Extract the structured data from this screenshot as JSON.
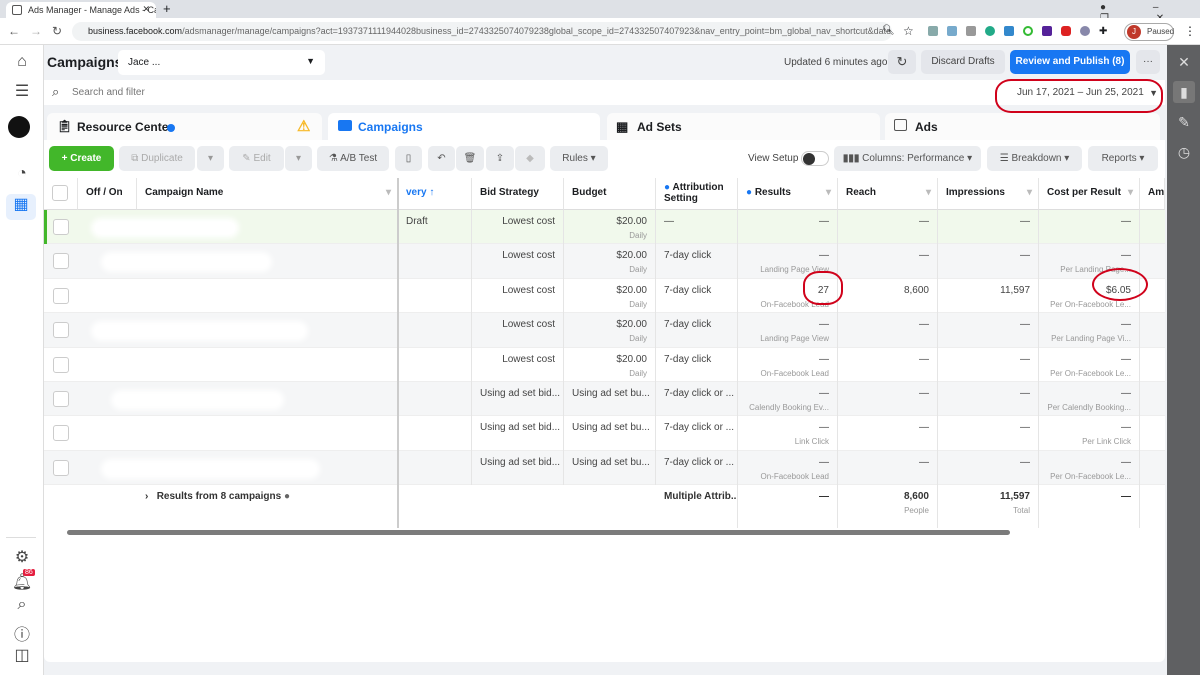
{
  "browser": {
    "tab_title": "Ads Manager - Manage Ads - Ca",
    "url_host": "business.facebook.com",
    "url_path": "/adsmanager/manage/campaigns?act=1937371111944028business_id=2743325074079238global_scope_id=274332507407923&nav_entry_point=bm_global_nav_shortcut&date...",
    "profile_status": "Paused",
    "profile_initial": "J"
  },
  "header": {
    "title": "Campaigns",
    "account": "Jace ...",
    "updated": "Updated 6 minutes ago",
    "discard": "Discard Drafts",
    "publish": "Review and Publish (8)",
    "more": "···"
  },
  "search": {
    "placeholder": "Search and filter",
    "date_range": "Jun 17, 2021 – Jun 25, 2021"
  },
  "tabs": [
    {
      "label": "Resource Center"
    },
    {
      "label": "Campaigns",
      "active": true
    },
    {
      "label": "Ad Sets"
    },
    {
      "label": "Ads"
    }
  ],
  "toolbar": {
    "create": "+ Create",
    "duplicate": "Duplicate",
    "edit": "Edit",
    "ab_test": "A/B Test",
    "rules": "Rules",
    "view_setup": "View Setup",
    "columns": "Columns: Performance",
    "breakdown": "Breakdown",
    "reports": "Reports"
  },
  "sidebar": {
    "notification_count": "86"
  },
  "colors": {
    "accent": "#1877f2",
    "create": "#42b72a",
    "annotation": "#d0021b",
    "draft_row": "#f1f9ec"
  },
  "table": {
    "headers": [
      "Off / On",
      "Campaign Name",
      "very ↑",
      "Bid Strategy",
      "Budget",
      "Attribution Setting",
      "Results",
      "Reach",
      "Impressions",
      "Cost per Result",
      "Amo"
    ],
    "rows": [
      {
        "delivery": "Draft",
        "bid": "Lowest cost",
        "budget": "$20.00",
        "budget_sub": "Daily",
        "attr": "—",
        "results": "—",
        "results_sub": "",
        "reach": "—",
        "impr": "—",
        "cpr": "—",
        "cpr_sub": ""
      },
      {
        "delivery": "",
        "bid": "Lowest cost",
        "budget": "$20.00",
        "budget_sub": "Daily",
        "attr": "7-day click",
        "results": "—",
        "results_sub": "Landing Page View",
        "reach": "—",
        "impr": "—",
        "cpr": "—",
        "cpr_sub": "Per Landing Page..."
      },
      {
        "delivery": "",
        "bid": "Lowest cost",
        "budget": "$20.00",
        "budget_sub": "Daily",
        "attr": "7-day click",
        "results": "27",
        "results_sub": "On-Facebook Lead",
        "reach": "8,600",
        "impr": "11,597",
        "cpr": "$6.05",
        "cpr_sub": "Per On-Facebook Le..."
      },
      {
        "delivery": "",
        "bid": "Lowest cost",
        "budget": "$20.00",
        "budget_sub": "Daily",
        "attr": "7-day click",
        "results": "—",
        "results_sub": "Landing Page View",
        "reach": "—",
        "impr": "—",
        "cpr": "—",
        "cpr_sub": "Per Landing Page Vi..."
      },
      {
        "delivery": "",
        "bid": "Lowest cost",
        "budget": "$20.00",
        "budget_sub": "Daily",
        "attr": "7-day click",
        "results": "—",
        "results_sub": "On-Facebook Lead",
        "reach": "—",
        "impr": "—",
        "cpr": "—",
        "cpr_sub": "Per On-Facebook Le..."
      },
      {
        "delivery": "",
        "bid": "Using ad set bid...",
        "budget": "Using ad set bu...",
        "budget_sub": "",
        "attr": "7-day click or ...",
        "results": "—",
        "results_sub": "Calendly Booking Ev...",
        "reach": "—",
        "impr": "—",
        "cpr": "—",
        "cpr_sub": "Per Calendly Booking..."
      },
      {
        "delivery": "",
        "bid": "Using ad set bid...",
        "budget": "Using ad set bu...",
        "budget_sub": "",
        "attr": "7-day click or ...",
        "results": "—",
        "results_sub": "Link Click",
        "reach": "—",
        "impr": "—",
        "cpr": "—",
        "cpr_sub": "Per Link Click"
      },
      {
        "delivery": "",
        "bid": "Using ad set bid...",
        "budget": "Using ad set bu...",
        "budget_sub": "",
        "attr": "7-day click or ...",
        "results": "—",
        "results_sub": "On-Facebook Lead",
        "reach": "—",
        "impr": "—",
        "cpr": "—",
        "cpr_sub": "Per On-Facebook Le..."
      }
    ],
    "summary": {
      "label": "Results from 8 campaigns",
      "attr": "Multiple Attrib...",
      "results": "—",
      "reach": "8,600",
      "reach_sub": "People",
      "impr": "11,597",
      "impr_sub": "Total",
      "cpr": "—"
    }
  }
}
